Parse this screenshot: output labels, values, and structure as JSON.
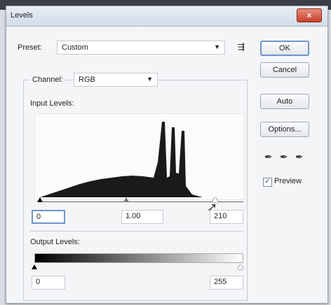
{
  "window": {
    "title": "Levels",
    "close_glyph": "×"
  },
  "preset": {
    "label": "Preset:",
    "value": "Custom",
    "menu_glyph": "⇶"
  },
  "channel": {
    "label": "Channel:",
    "value": "RGB"
  },
  "input_levels": {
    "label": "Input Levels:",
    "black": "0",
    "gamma": "1.00",
    "white": "210"
  },
  "output_levels": {
    "label": "Output Levels:",
    "black": "0",
    "white": "255"
  },
  "buttons": {
    "ok": "OK",
    "cancel": "Cancel",
    "auto": "Auto",
    "options": "Options..."
  },
  "preview": {
    "label": "Preview",
    "checked": true
  },
  "colors": {
    "accent": "#6f95c7",
    "close": "#c6402b",
    "histogram": "#1a1a1a"
  }
}
